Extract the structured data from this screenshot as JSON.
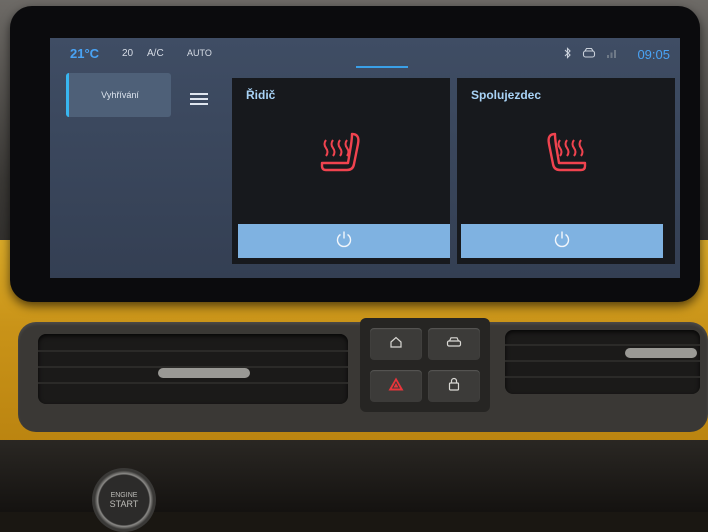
{
  "statusbar": {
    "temperature": "21°C",
    "fan_level": "20",
    "ac_label": "A/C",
    "auto_label": "AUTO",
    "time": "09:05",
    "icons": [
      "bluetooth-icon",
      "car-connect-icon",
      "signal-icon"
    ]
  },
  "sidebar": {
    "active_tab_label": "Vyhřívání"
  },
  "cards": {
    "driver": {
      "title": "Řidič",
      "icon": "heated-seat-icon",
      "state": "on",
      "button_icon": "power-icon"
    },
    "passenger": {
      "title": "Spolujezdec",
      "icon": "heated-seat-icon",
      "state": "on",
      "button_icon": "power-icon"
    }
  },
  "console": {
    "buttons": [
      "home-icon",
      "car-icon",
      "hazard-icon",
      "lock-icon"
    ]
  },
  "engine_button": {
    "line1": "ENGINE",
    "line2": "START"
  },
  "colors": {
    "accent": "#49a3f5",
    "seat_heat": "#f0434f",
    "power_button": "#7fb2e1",
    "trim_yellow": "#d9a928"
  }
}
